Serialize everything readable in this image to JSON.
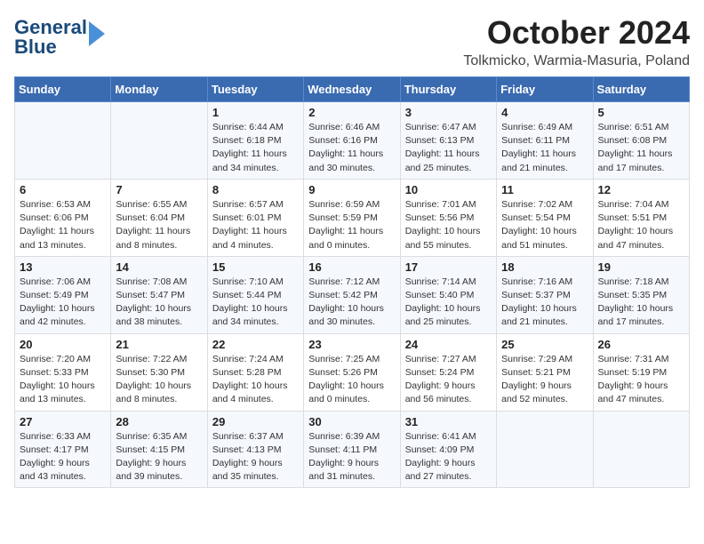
{
  "header": {
    "logo_line1": "General",
    "logo_line2": "Blue",
    "month": "October 2024",
    "location": "Tolkmicko, Warmia-Masuria, Poland"
  },
  "days_of_week": [
    "Sunday",
    "Monday",
    "Tuesday",
    "Wednesday",
    "Thursday",
    "Friday",
    "Saturday"
  ],
  "weeks": [
    [
      {
        "day": "",
        "info": ""
      },
      {
        "day": "",
        "info": ""
      },
      {
        "day": "1",
        "info": "Sunrise: 6:44 AM\nSunset: 6:18 PM\nDaylight: 11 hours\nand 34 minutes."
      },
      {
        "day": "2",
        "info": "Sunrise: 6:46 AM\nSunset: 6:16 PM\nDaylight: 11 hours\nand 30 minutes."
      },
      {
        "day": "3",
        "info": "Sunrise: 6:47 AM\nSunset: 6:13 PM\nDaylight: 11 hours\nand 25 minutes."
      },
      {
        "day": "4",
        "info": "Sunrise: 6:49 AM\nSunset: 6:11 PM\nDaylight: 11 hours\nand 21 minutes."
      },
      {
        "day": "5",
        "info": "Sunrise: 6:51 AM\nSunset: 6:08 PM\nDaylight: 11 hours\nand 17 minutes."
      }
    ],
    [
      {
        "day": "6",
        "info": "Sunrise: 6:53 AM\nSunset: 6:06 PM\nDaylight: 11 hours\nand 13 minutes."
      },
      {
        "day": "7",
        "info": "Sunrise: 6:55 AM\nSunset: 6:04 PM\nDaylight: 11 hours\nand 8 minutes."
      },
      {
        "day": "8",
        "info": "Sunrise: 6:57 AM\nSunset: 6:01 PM\nDaylight: 11 hours\nand 4 minutes."
      },
      {
        "day": "9",
        "info": "Sunrise: 6:59 AM\nSunset: 5:59 PM\nDaylight: 11 hours\nand 0 minutes."
      },
      {
        "day": "10",
        "info": "Sunrise: 7:01 AM\nSunset: 5:56 PM\nDaylight: 10 hours\nand 55 minutes."
      },
      {
        "day": "11",
        "info": "Sunrise: 7:02 AM\nSunset: 5:54 PM\nDaylight: 10 hours\nand 51 minutes."
      },
      {
        "day": "12",
        "info": "Sunrise: 7:04 AM\nSunset: 5:51 PM\nDaylight: 10 hours\nand 47 minutes."
      }
    ],
    [
      {
        "day": "13",
        "info": "Sunrise: 7:06 AM\nSunset: 5:49 PM\nDaylight: 10 hours\nand 42 minutes."
      },
      {
        "day": "14",
        "info": "Sunrise: 7:08 AM\nSunset: 5:47 PM\nDaylight: 10 hours\nand 38 minutes."
      },
      {
        "day": "15",
        "info": "Sunrise: 7:10 AM\nSunset: 5:44 PM\nDaylight: 10 hours\nand 34 minutes."
      },
      {
        "day": "16",
        "info": "Sunrise: 7:12 AM\nSunset: 5:42 PM\nDaylight: 10 hours\nand 30 minutes."
      },
      {
        "day": "17",
        "info": "Sunrise: 7:14 AM\nSunset: 5:40 PM\nDaylight: 10 hours\nand 25 minutes."
      },
      {
        "day": "18",
        "info": "Sunrise: 7:16 AM\nSunset: 5:37 PM\nDaylight: 10 hours\nand 21 minutes."
      },
      {
        "day": "19",
        "info": "Sunrise: 7:18 AM\nSunset: 5:35 PM\nDaylight: 10 hours\nand 17 minutes."
      }
    ],
    [
      {
        "day": "20",
        "info": "Sunrise: 7:20 AM\nSunset: 5:33 PM\nDaylight: 10 hours\nand 13 minutes."
      },
      {
        "day": "21",
        "info": "Sunrise: 7:22 AM\nSunset: 5:30 PM\nDaylight: 10 hours\nand 8 minutes."
      },
      {
        "day": "22",
        "info": "Sunrise: 7:24 AM\nSunset: 5:28 PM\nDaylight: 10 hours\nand 4 minutes."
      },
      {
        "day": "23",
        "info": "Sunrise: 7:25 AM\nSunset: 5:26 PM\nDaylight: 10 hours\nand 0 minutes."
      },
      {
        "day": "24",
        "info": "Sunrise: 7:27 AM\nSunset: 5:24 PM\nDaylight: 9 hours\nand 56 minutes."
      },
      {
        "day": "25",
        "info": "Sunrise: 7:29 AM\nSunset: 5:21 PM\nDaylight: 9 hours\nand 52 minutes."
      },
      {
        "day": "26",
        "info": "Sunrise: 7:31 AM\nSunset: 5:19 PM\nDaylight: 9 hours\nand 47 minutes."
      }
    ],
    [
      {
        "day": "27",
        "info": "Sunrise: 6:33 AM\nSunset: 4:17 PM\nDaylight: 9 hours\nand 43 minutes."
      },
      {
        "day": "28",
        "info": "Sunrise: 6:35 AM\nSunset: 4:15 PM\nDaylight: 9 hours\nand 39 minutes."
      },
      {
        "day": "29",
        "info": "Sunrise: 6:37 AM\nSunset: 4:13 PM\nDaylight: 9 hours\nand 35 minutes."
      },
      {
        "day": "30",
        "info": "Sunrise: 6:39 AM\nSunset: 4:11 PM\nDaylight: 9 hours\nand 31 minutes."
      },
      {
        "day": "31",
        "info": "Sunrise: 6:41 AM\nSunset: 4:09 PM\nDaylight: 9 hours\nand 27 minutes."
      },
      {
        "day": "",
        "info": ""
      },
      {
        "day": "",
        "info": ""
      }
    ]
  ]
}
